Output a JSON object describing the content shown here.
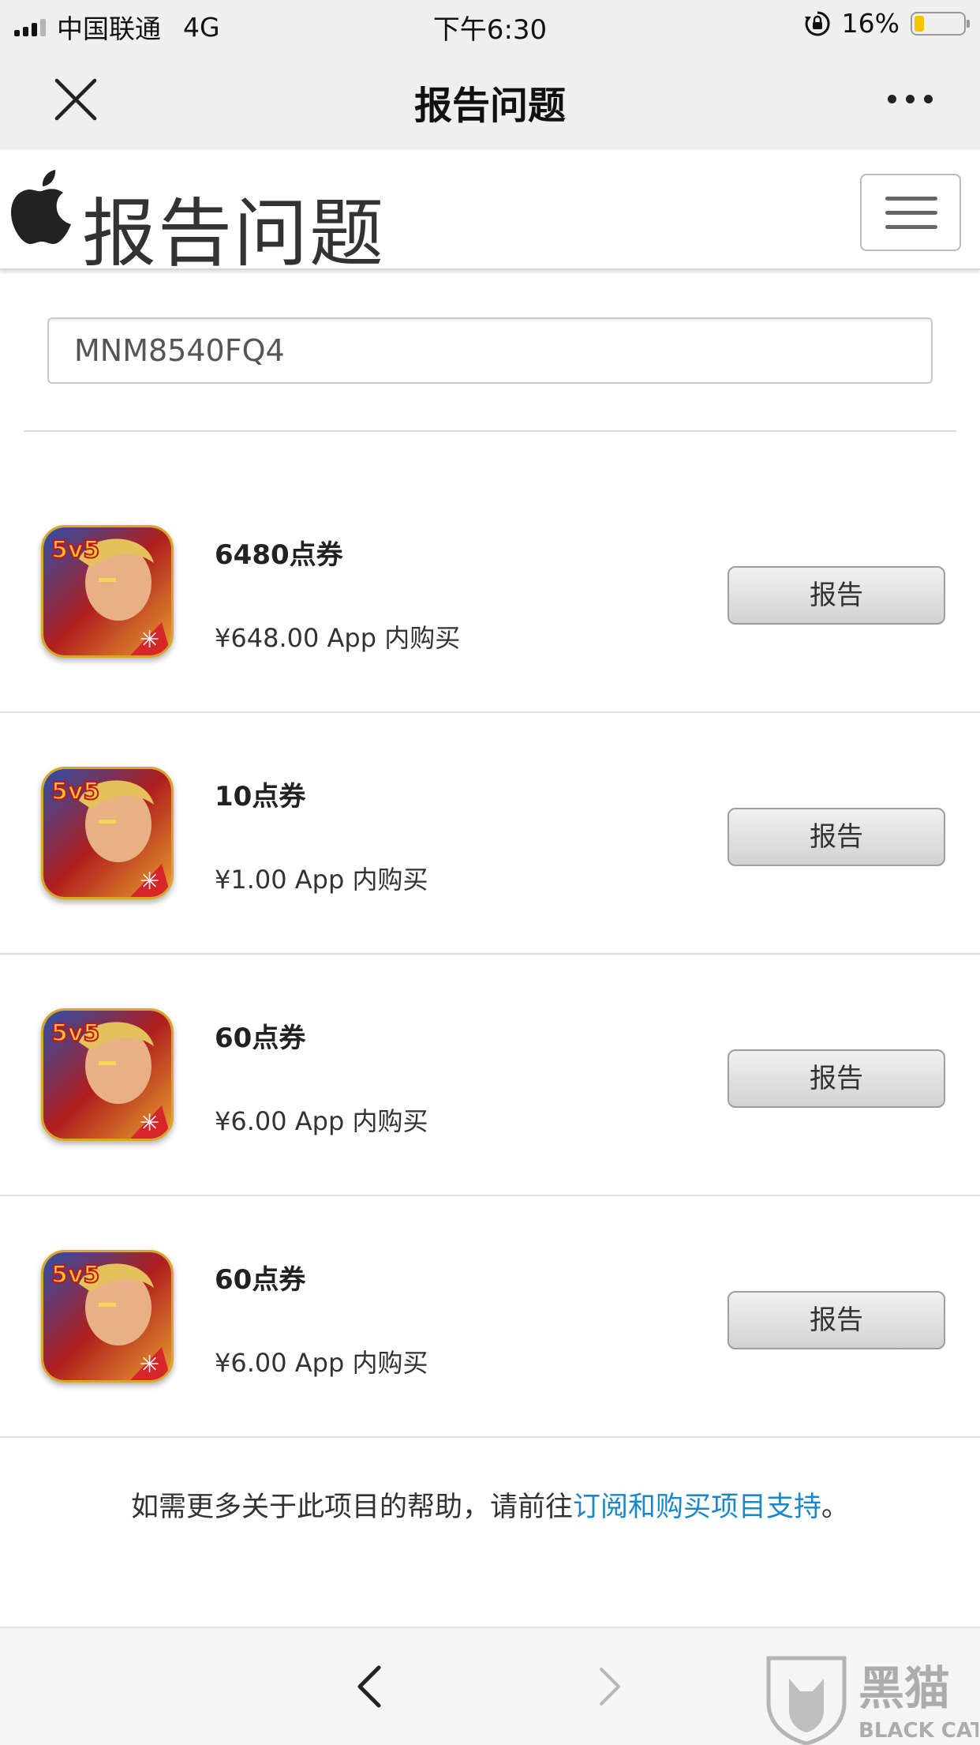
{
  "status_bar": {
    "carrier": "中国联通",
    "network": "4G",
    "time": "下午6:30",
    "battery": "16%",
    "battery_level": 0.16
  },
  "titlebar": {
    "title": "报告问题",
    "close_icon": "close-icon",
    "more_icon": "more-icon"
  },
  "header": {
    "title": "报告问题",
    "logo": "apple-logo",
    "menu_icon": "hamburger-icon"
  },
  "order_id": "MNM8540FQ4",
  "items": [
    {
      "name": "6480点券",
      "price": "¥648.00 App 内购买",
      "button": "报告"
    },
    {
      "name": "10点券",
      "price": "¥1.00 App 内购买",
      "button": "报告"
    },
    {
      "name": "60点券",
      "price": "¥6.00 App 内购买",
      "button": "报告"
    },
    {
      "name": "60点券",
      "price": "¥6.00 App 内购买",
      "button": "报告"
    }
  ],
  "help": {
    "prefix": "如需更多关于此项目的帮助，请前往",
    "link": "订阅和购买项目支持",
    "suffix": "。"
  },
  "bottom_nav": {
    "back_icon": "back-arrow-icon",
    "forward_icon": "forward-arrow-icon"
  },
  "watermark": {
    "text_cn": "黑猫",
    "text_en": "BLACK CAT"
  },
  "colors": {
    "link": "#1a87c9",
    "battery": "#f5c400",
    "bar_bg": "#efefef"
  }
}
